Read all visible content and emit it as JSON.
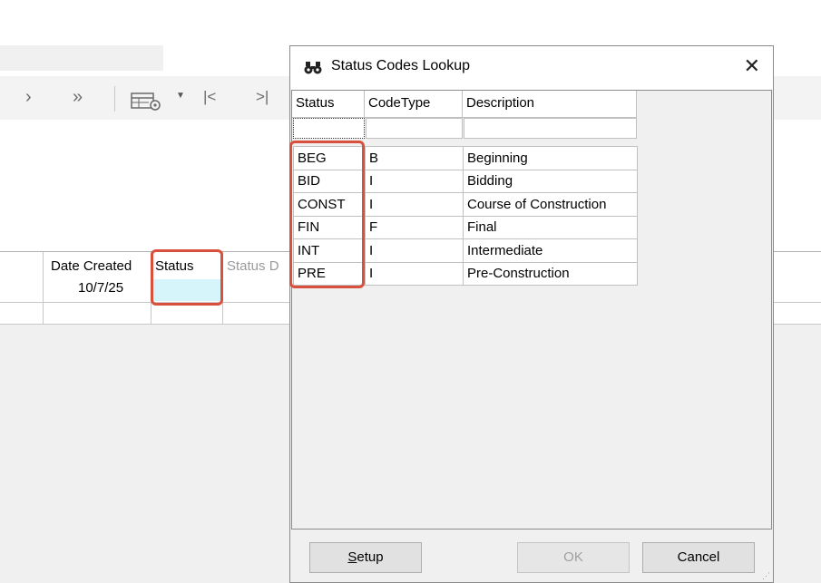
{
  "toolbar": {
    "next": "›",
    "last": "»",
    "first_record": "|<",
    "last_record": ">|"
  },
  "grid": {
    "columns": [
      "Date Created",
      "Status",
      "Status D"
    ],
    "row": {
      "date_created": "10/7/25",
      "status": ""
    }
  },
  "dialog": {
    "title": "Status Codes Lookup",
    "close": "✕",
    "columns": [
      "Status",
      "CodeType",
      "Description"
    ],
    "rows": [
      {
        "status": "BEG",
        "code_type": "B",
        "description": "Beginning"
      },
      {
        "status": "BID",
        "code_type": "I",
        "description": "Bidding"
      },
      {
        "status": "CONST",
        "code_type": "I",
        "description": "Course of Construction"
      },
      {
        "status": "FIN",
        "code_type": "F",
        "description": "Final"
      },
      {
        "status": "INT",
        "code_type": "I",
        "description": "Intermediate"
      },
      {
        "status": "PRE",
        "code_type": "I",
        "description": "Pre-Construction"
      }
    ],
    "buttons": {
      "setup_prefix": "",
      "setup_mnemonic": "S",
      "setup_rest": "etup",
      "ok": "OK",
      "cancel": "Cancel"
    }
  },
  "colors": {
    "highlight": "#d9503d",
    "selected_cell": "#d6f5fb"
  }
}
